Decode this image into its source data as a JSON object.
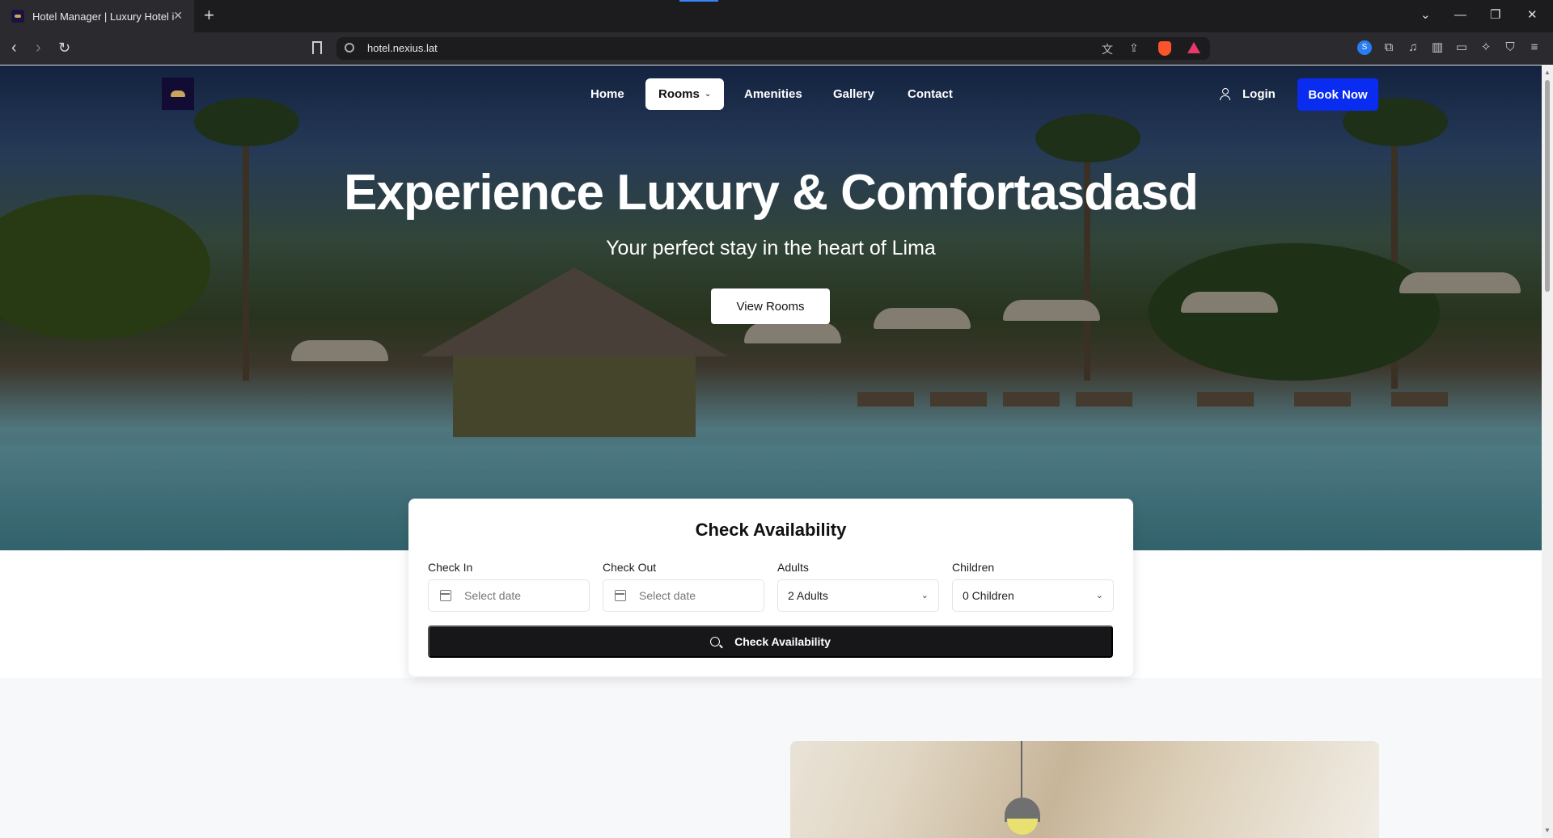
{
  "browser": {
    "tab_title": "Hotel Manager | Luxury Hotel in Lima",
    "new_tab": "+",
    "url": "hotel.nexius.lat"
  },
  "nav": {
    "items": [
      {
        "label": "Home"
      },
      {
        "label": "Rooms"
      },
      {
        "label": "Amenities"
      },
      {
        "label": "Gallery"
      },
      {
        "label": "Contact"
      }
    ],
    "login": "Login",
    "book_now": "Book Now"
  },
  "hero": {
    "title": "Experience Luxury & Comfortasdasd",
    "subtitle": "Your perfect stay in the heart of Lima",
    "cta": "View Rooms"
  },
  "availability": {
    "title": "Check Availability",
    "check_in_label": "Check In",
    "check_in_value": "Select date",
    "check_out_label": "Check Out",
    "check_out_value": "Select date",
    "adults_label": "Adults",
    "adults_value": "2 Adults",
    "children_label": "Children",
    "children_value": "0 Children",
    "submit": "Check Availability"
  },
  "colors": {
    "primary_button": "#0a2bf0",
    "dark_button": "#17171a"
  }
}
